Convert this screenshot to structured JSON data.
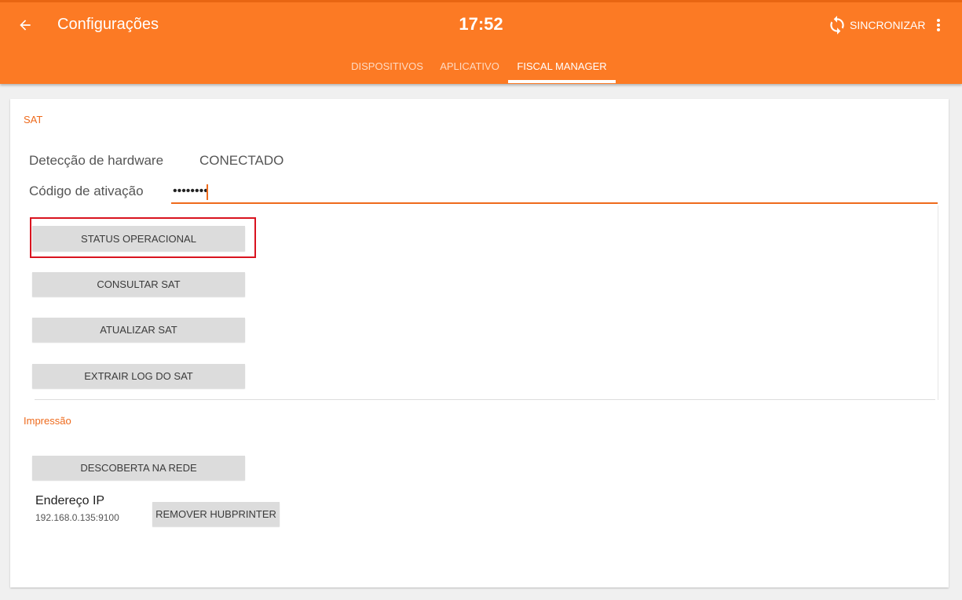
{
  "appbar": {
    "title": "Configurações",
    "clock": "17:52",
    "sync_label": "SINCRONIZAR",
    "color": "#fc7a24"
  },
  "tabs": [
    {
      "label": "DISPOSITIVOS",
      "active": false
    },
    {
      "label": "APLICATIVO",
      "active": false
    },
    {
      "label": "FISCAL MANAGER",
      "active": true
    }
  ],
  "sat": {
    "section_title": "SAT",
    "hardware_label": "Detecção de hardware",
    "hardware_value": "CONECTADO",
    "activation_label": "Código de ativação",
    "activation_value": "••••••••",
    "buttons": {
      "status": "STATUS OPERACIONAL",
      "consultar": "CONSULTAR SAT",
      "atualizar": "ATUALIZAR SAT",
      "extrair_log": "EXTRAIR LOG DO SAT"
    }
  },
  "impressao": {
    "section_title": "Impressão",
    "discover_button": "DESCOBERTA NA REDE",
    "ip_label": "Endereço IP",
    "ip_value": "192.168.0.135:9100",
    "remove_button": "REMOVER HUBPRINTER"
  },
  "icons": {
    "back": "arrow-left-icon",
    "sync": "sync-icon",
    "more": "more-vert-icon"
  },
  "colors": {
    "accent": "#ee6a1c",
    "highlight": "#d9131f"
  }
}
